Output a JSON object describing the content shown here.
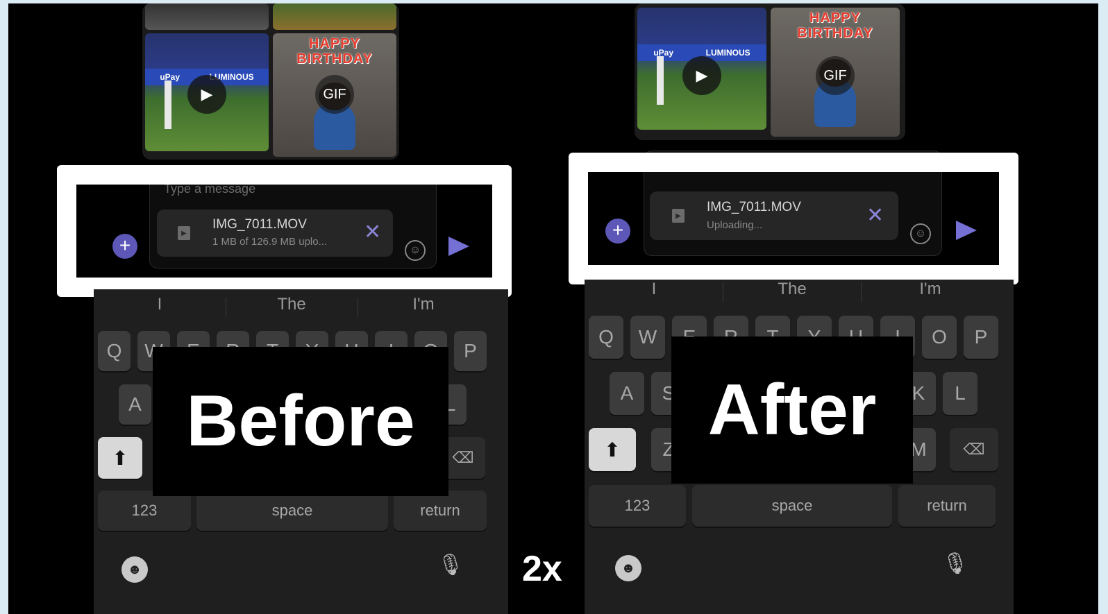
{
  "before": {
    "label": "Before",
    "placeholder": "Type a message",
    "file_name": "IMG_7011.MOV",
    "file_status": "1 MB of 126.9 MB uplo...",
    "gif_label": "GIF",
    "bday_text": "HAPPY BIRTHDAY",
    "suggestions": [
      "I",
      "The",
      "I'm"
    ],
    "row1": [
      "Q",
      "W",
      "E",
      "R",
      "T",
      "Y",
      "U",
      "I",
      "O",
      "P"
    ],
    "row2": [
      "A",
      "L"
    ],
    "keys": {
      "numbers": "123",
      "space": "space",
      "return": "return"
    }
  },
  "after": {
    "label": "After",
    "file_name": "IMG_7011.MOV",
    "file_status": "Uploading...",
    "gif_label": "GIF",
    "bday_text": "HAPPY BIRTHDAY",
    "suggestions": [
      "I",
      "The",
      "I'm"
    ],
    "row1": [
      "Q",
      "W",
      "E",
      "R",
      "T",
      "Y",
      "U",
      "I",
      "O",
      "P"
    ],
    "row2": [
      "A",
      "S",
      "K",
      "L"
    ],
    "row3": [
      "Z",
      "M"
    ],
    "keys": {
      "numbers": "123",
      "space": "space",
      "return": "return"
    }
  },
  "speed_label": "2x",
  "icons": {
    "play": "play-icon",
    "add": "plus-icon",
    "emoji": "smiley-icon",
    "send": "send-icon",
    "remove": "close-icon",
    "file": "video-file-icon",
    "shift": "shift-icon",
    "backspace": "backspace-icon",
    "mic": "microphone-icon"
  },
  "colors": {
    "accent": "#5d57b8",
    "highlight": "#ffffff",
    "background": "#000000",
    "frame": "#dcecf5"
  }
}
